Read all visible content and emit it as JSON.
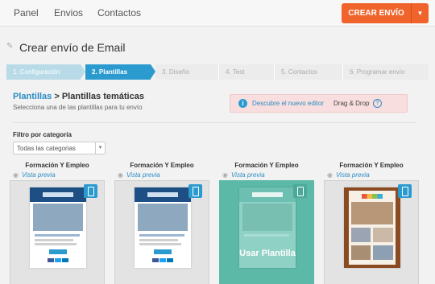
{
  "nav": {
    "items": [
      "Panel",
      "Envios",
      "Contactos"
    ],
    "cta_label": "CREAR ENVÍO"
  },
  "page": {
    "title": "Crear envío de Email"
  },
  "steps": [
    "1. Configuración",
    "2. Plantillas",
    "3. Diseño",
    "4. Test",
    "5. Contactos",
    "6. Programar envío"
  ],
  "breadcrumb": {
    "parent": "Plantillas",
    "separator": " > ",
    "current": "Plantillas temáticas"
  },
  "subtitle": "Selecciona una de las plantillas para tu envío",
  "info": {
    "link_text": "Descubre el nuevo editor",
    "strong_text": "Drag & Drop",
    "help_icon": "question-circle-icon"
  },
  "filter": {
    "label": "Filtro por categoría",
    "selected": "Todas las categorias"
  },
  "templates": [
    {
      "title": "Formación Y Empleo",
      "preview": "Vista previa"
    },
    {
      "title": "Formación Y Empleo",
      "preview": "Vista previa"
    },
    {
      "title": "Formación Y Empleo",
      "preview": "Vista previa",
      "hover_label": "Usar Plantilla"
    },
    {
      "title": "Formación Y Empleo",
      "preview": "Vista previa"
    }
  ],
  "colors": {
    "accent": "#f0642c",
    "primary": "#2b9bcf",
    "hover": "#5cb9a8"
  }
}
